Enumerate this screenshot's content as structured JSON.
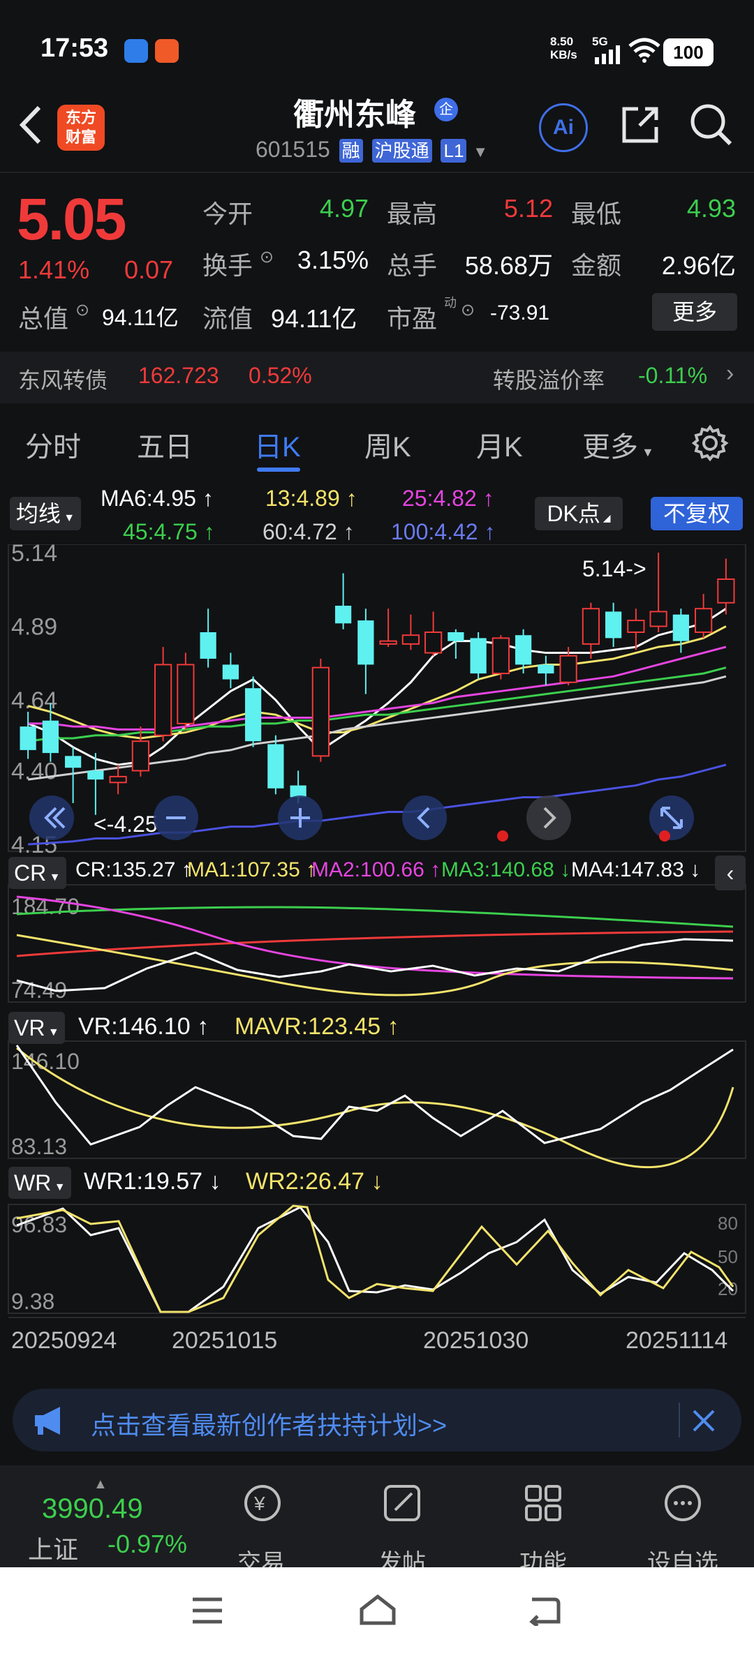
{
  "status_bar": {
    "time": "17:53",
    "net_speed": "8.50",
    "net_unit": "KB/s",
    "signal": "5G",
    "battery": "100"
  },
  "header": {
    "logo_line1": "东方",
    "logo_line2": "财富",
    "stock_name": "衢州东峰",
    "name_badge": "企",
    "code": "601515",
    "tags": [
      "融",
      "沪股通",
      "L1"
    ],
    "ai_label": "Ai"
  },
  "quote": {
    "price": "5.05",
    "change_pct": "1.41%",
    "change": "0.07",
    "open_label": "今开",
    "open": "4.97",
    "high_label": "最高",
    "high": "5.12",
    "low_label": "最低",
    "low": "4.93",
    "turnover_label": "换手",
    "turnover": "3.15%",
    "volume_label": "总手",
    "volume": "58.68万",
    "amount_label": "金额",
    "amount": "2.96亿",
    "mktcap_label": "总值",
    "mktcap": "94.11亿",
    "float_label": "流值",
    "float_cap": "94.11亿",
    "pe_label": "市盈",
    "pe_sup": "动",
    "pe": "-73.91",
    "more": "更多"
  },
  "convertible": {
    "name": "东风转债",
    "price": "162.723",
    "pct": "0.52%",
    "premium_label": "转股溢价率",
    "premium": "-0.11%"
  },
  "tabs": [
    "分时",
    "五日",
    "日K",
    "周K",
    "月K",
    "更多"
  ],
  "active_tab": "日K",
  "ma_bar": {
    "selector": "均线",
    "ma6": "MA6:4.95",
    "ma13": "13:4.89",
    "ma25": "25:4.82",
    "ma45": "45:4.75",
    "ma60": "60:4.72",
    "ma100": "100:4.42",
    "dk": "DK点",
    "adjust": "不复权"
  },
  "chart_data": {
    "type": "candlestick",
    "y_ticks": [
      "5.14",
      "4.89",
      "4.64",
      "4.40",
      "4.15"
    ],
    "ylim": [
      4.15,
      5.14
    ],
    "high_annotation": "5.14->",
    "low_annotation": "<-4.25",
    "x_ticks": [
      "20250924",
      "20251015",
      "20251030",
      "20251114"
    ],
    "candles": [
      {
        "o": 4.55,
        "c": 4.47,
        "h": 4.6,
        "l": 4.44
      },
      {
        "o": 4.57,
        "c": 4.46,
        "h": 4.63,
        "l": 4.43
      },
      {
        "o": 4.45,
        "c": 4.41,
        "h": 4.48,
        "l": 4.29
      },
      {
        "o": 4.4,
        "c": 4.37,
        "h": 4.46,
        "l": 4.25
      },
      {
        "o": 4.36,
        "c": 4.38,
        "h": 4.42,
        "l": 4.32
      },
      {
        "o": 4.4,
        "c": 4.5,
        "h": 4.55,
        "l": 4.38
      },
      {
        "o": 4.52,
        "c": 4.76,
        "h": 4.82,
        "l": 4.5
      },
      {
        "o": 4.56,
        "c": 4.76,
        "h": 4.8,
        "l": 4.54
      },
      {
        "o": 4.87,
        "c": 4.78,
        "h": 4.95,
        "l": 4.75
      },
      {
        "o": 4.76,
        "c": 4.71,
        "h": 4.8,
        "l": 4.68
      },
      {
        "o": 4.68,
        "c": 4.5,
        "h": 4.72,
        "l": 4.48
      },
      {
        "o": 4.49,
        "c": 4.34,
        "h": 4.52,
        "l": 4.32
      },
      {
        "o": 4.35,
        "c": 4.31,
        "h": 4.4,
        "l": 4.29
      },
      {
        "o": 4.45,
        "c": 4.75,
        "h": 4.78,
        "l": 4.43
      },
      {
        "o": 4.96,
        "c": 4.9,
        "h": 5.07,
        "l": 4.88
      },
      {
        "o": 4.91,
        "c": 4.76,
        "h": 4.95,
        "l": 4.66
      },
      {
        "o": 4.83,
        "c": 4.84,
        "h": 4.95,
        "l": 4.82
      },
      {
        "o": 4.83,
        "c": 4.86,
        "h": 4.93,
        "l": 4.81
      },
      {
        "o": 4.8,
        "c": 4.87,
        "h": 4.94,
        "l": 4.79
      },
      {
        "o": 4.87,
        "c": 4.84,
        "h": 4.88,
        "l": 4.78
      },
      {
        "o": 4.85,
        "c": 4.73,
        "h": 4.87,
        "l": 4.71
      },
      {
        "o": 4.73,
        "c": 4.85,
        "h": 4.86,
        "l": 4.71
      },
      {
        "o": 4.86,
        "c": 4.76,
        "h": 4.88,
        "l": 4.73
      },
      {
        "o": 4.76,
        "c": 4.73,
        "h": 4.79,
        "l": 4.69
      },
      {
        "o": 4.7,
        "c": 4.79,
        "h": 4.82,
        "l": 4.69
      },
      {
        "o": 4.83,
        "c": 4.95,
        "h": 4.97,
        "l": 4.78
      },
      {
        "o": 4.94,
        "c": 4.85,
        "h": 4.97,
        "l": 4.82
      },
      {
        "o": 4.87,
        "c": 4.91,
        "h": 4.95,
        "l": 4.81
      },
      {
        "o": 4.89,
        "c": 4.94,
        "h": 5.14,
        "l": 4.87
      },
      {
        "o": 4.93,
        "c": 4.84,
        "h": 4.95,
        "l": 4.8
      },
      {
        "o": 4.87,
        "c": 4.95,
        "h": 5.0,
        "l": 4.85
      },
      {
        "o": 4.97,
        "c": 5.05,
        "h": 5.12,
        "l": 4.93
      }
    ],
    "series": [
      {
        "name": "MA6",
        "color": "#ffffff",
        "values": [
          4.56,
          4.53,
          4.48,
          4.44,
          4.42,
          4.43,
          4.48,
          4.55,
          4.61,
          4.67,
          4.71,
          4.64,
          4.55,
          4.47,
          4.52,
          4.57,
          4.63,
          4.7,
          4.79,
          4.84,
          4.84,
          4.83,
          4.81,
          4.8,
          4.8,
          4.8,
          4.81,
          4.82,
          4.86,
          4.88,
          4.9,
          4.95
        ]
      },
      {
        "name": "13",
        "color": "#f3e36b",
        "values": [
          4.62,
          4.6,
          4.57,
          4.54,
          4.52,
          4.51,
          4.52,
          4.53,
          4.55,
          4.58,
          4.6,
          4.59,
          4.56,
          4.53,
          4.53,
          4.55,
          4.58,
          4.61,
          4.64,
          4.67,
          4.71,
          4.73,
          4.75,
          4.76,
          4.76,
          4.77,
          4.78,
          4.8,
          4.82,
          4.83,
          4.85,
          4.89
        ]
      },
      {
        "name": "25",
        "color": "#e545e0",
        "values": [
          4.56,
          4.56,
          4.55,
          4.55,
          4.54,
          4.54,
          4.54,
          4.55,
          4.56,
          4.57,
          4.58,
          4.58,
          4.58,
          4.58,
          4.59,
          4.6,
          4.61,
          4.62,
          4.63,
          4.65,
          4.66,
          4.67,
          4.68,
          4.69,
          4.7,
          4.71,
          4.72,
          4.74,
          4.76,
          4.78,
          4.8,
          4.82
        ]
      },
      {
        "name": "45",
        "color": "#3ccf4e",
        "values": [
          4.5,
          4.51,
          4.51,
          4.52,
          4.52,
          4.53,
          4.53,
          4.54,
          4.55,
          4.55,
          4.56,
          4.56,
          4.57,
          4.57,
          4.58,
          4.59,
          4.59,
          4.6,
          4.61,
          4.62,
          4.63,
          4.64,
          4.65,
          4.66,
          4.67,
          4.68,
          4.69,
          4.7,
          4.71,
          4.72,
          4.73,
          4.75
        ]
      },
      {
        "name": "60",
        "color": "#d0d0d0",
        "values": [
          4.37,
          4.38,
          4.39,
          4.4,
          4.41,
          4.42,
          4.43,
          4.44,
          4.46,
          4.47,
          4.49,
          4.5,
          4.51,
          4.52,
          4.54,
          4.55,
          4.56,
          4.57,
          4.58,
          4.59,
          4.6,
          4.61,
          4.62,
          4.63,
          4.64,
          4.65,
          4.66,
          4.67,
          4.68,
          4.69,
          4.7,
          4.72
        ]
      },
      {
        "name": "100",
        "color": "#4a52e0",
        "values": [
          4.15,
          4.155,
          4.16,
          4.17,
          4.17,
          4.18,
          4.19,
          4.19,
          4.2,
          4.21,
          4.21,
          4.22,
          4.23,
          4.23,
          4.24,
          4.25,
          4.26,
          4.26,
          4.27,
          4.28,
          4.29,
          4.3,
          4.31,
          4.31,
          4.32,
          4.33,
          4.34,
          4.35,
          4.37,
          4.38,
          4.4,
          4.42
        ]
      }
    ]
  },
  "chart_controls": [
    "rewind",
    "zoom-out",
    "zoom-in",
    "prev",
    "next",
    "fullscreen"
  ],
  "cr": {
    "selector": "CR",
    "cr": "CR:135.27",
    "ma1": "MA1:107.35",
    "ma2": "MA2:100.66",
    "ma3": "MA3:140.68",
    "ma4": "MA4:147.83",
    "y_top": "184.70",
    "y_bottom": "74.49"
  },
  "vr": {
    "selector": "VR",
    "vr": "VR:146.10",
    "mavr": "MAVR:123.45",
    "y_top": "146.10",
    "y_bottom": "83.13"
  },
  "wr": {
    "selector": "WR",
    "wr1": "WR1:19.57",
    "wr2": "WR2:26.47",
    "y_top": "96.83",
    "y_bottom": "9.38",
    "ref_80": "80",
    "ref_50": "50",
    "ref_20": "20"
  },
  "banner": {
    "text": "点击查看最新创作者扶持计划>>"
  },
  "bottom": {
    "index_value": "3990.49",
    "index_name": "上证",
    "index_pct": "-0.97%",
    "items": [
      "交易",
      "发帖",
      "功能",
      "设自选"
    ]
  }
}
